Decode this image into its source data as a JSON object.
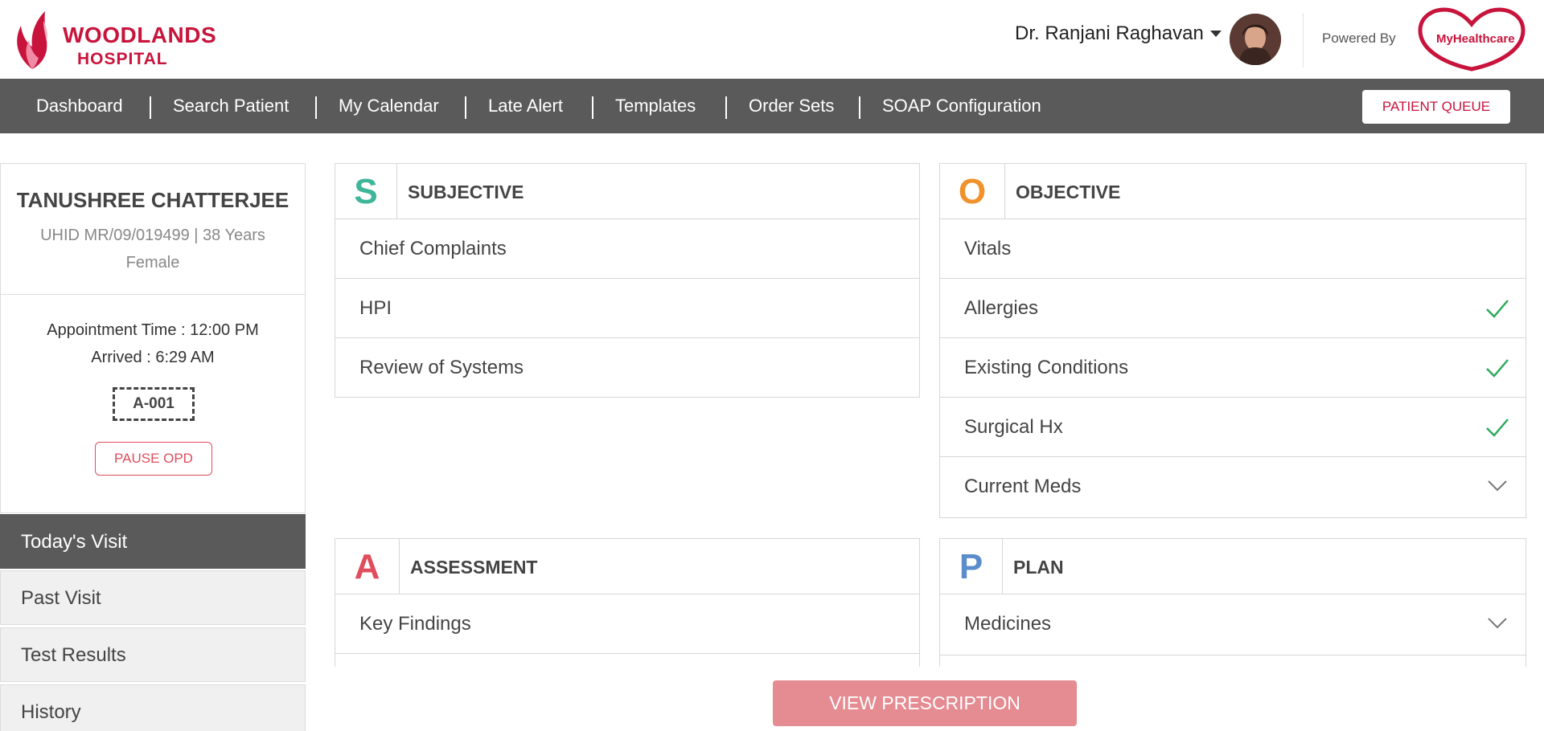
{
  "header": {
    "logo_line1": "WOODLANDS",
    "logo_line2": "HOSPITAL",
    "doctor_name": "Dr. Ranjani Raghavan",
    "powered_by": "Powered By",
    "partner_logo_text": "MyHealthcare"
  },
  "nav": {
    "items": [
      "Dashboard",
      "Search Patient",
      "My Calendar",
      "Late Alert",
      "Templates",
      "Order Sets",
      "SOAP Configuration"
    ],
    "queue_button": "PATIENT QUEUE"
  },
  "patient": {
    "name": "TANUSHREE CHATTERJEE",
    "info": "UHID MR/09/019499 | 38 Years Female",
    "appointment": "Appointment Time : 12:00 PM",
    "arrived": "Arrived : 6:29 AM",
    "token": "A-001",
    "pause_button": "PAUSE OPD"
  },
  "sidebar": {
    "tabs": [
      "Today's Visit",
      "Past Visit",
      "Test Results",
      "History"
    ],
    "active": "Today's Visit"
  },
  "soap": {
    "subjective": {
      "letter": "S",
      "title": "SUBJECTIVE",
      "rows": [
        "Chief Complaints",
        "HPI",
        "Review of Systems"
      ]
    },
    "objective": {
      "letter": "O",
      "title": "OBJECTIVE",
      "rows": [
        "Vitals",
        "Allergies",
        "Existing Conditions",
        "Surgical Hx",
        "Current Meds"
      ]
    },
    "assessment": {
      "letter": "A",
      "title": "ASSESSMENT",
      "rows": [
        "Key Findings"
      ]
    },
    "plan": {
      "letter": "P",
      "title": "PLAN",
      "rows": [
        "Medicines"
      ]
    }
  },
  "actions": {
    "view_prescription": "VIEW PRESCRIPTION"
  },
  "colors": {
    "brand": "#c8143c",
    "nav_bg": "#5a5a5a",
    "subjective": "#3fb59a",
    "objective": "#f0922b",
    "assessment": "#e04d5c",
    "plan": "#5b8ccb",
    "check": "#2eaa5c"
  }
}
